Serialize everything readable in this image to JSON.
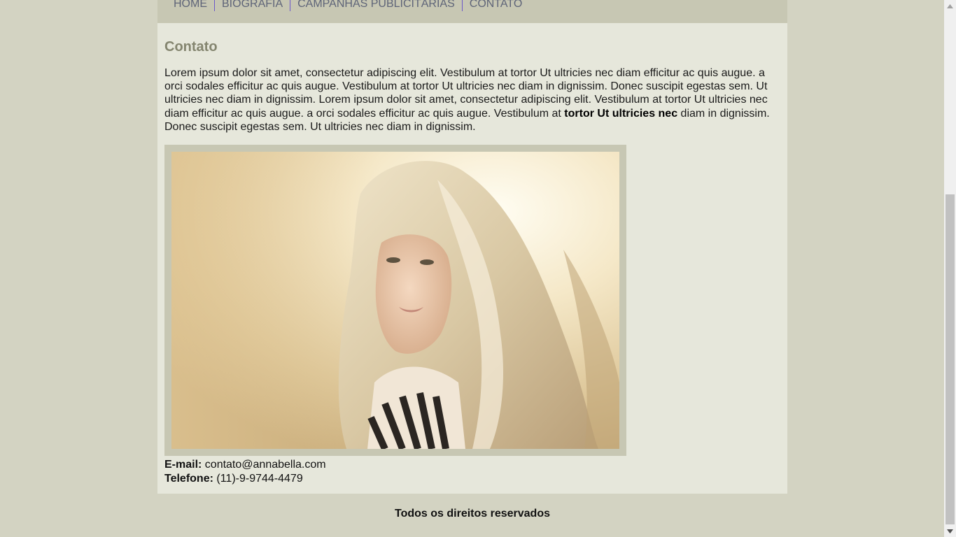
{
  "nav": {
    "items": [
      {
        "label": "HOME"
      },
      {
        "label": "BIOGRAFIA"
      },
      {
        "label": "CAMPANHAS PUBLICITÁRIAS"
      },
      {
        "label": "CONTATO"
      }
    ]
  },
  "main": {
    "title": "Contato",
    "intro_before": "Lorem ipsum dolor sit amet, consectetur adipiscing elit. Vestibulum at tortor Ut ultricies nec diam efficitur ac quis augue. a orci sodales efficitur ac quis augue. Vestibulum at tortor Ut ultricies nec diam in dignissim. Donec suscipit egestas sem. Ut ultricies nec diam in dignissim. Lorem ipsum dolor sit amet, consectetur adipiscing elit. Vestibulum at tortor Ut ultricies nec diam efficitur ac quis augue. a orci sodales efficitur ac quis augue. Vestibulum at ",
    "intro_bold": "tortor Ut ultricies nec",
    "intro_after": " diam in dignissim. Donec suscipit egestas sem. Ut ultricies nec diam in dignissim.",
    "contact": {
      "email_label": "E-mail:",
      "email_value": " contato@annabella.com",
      "phone_label": "Telefone:",
      "phone_value": " (11)-9-9744-4479"
    }
  },
  "footer": {
    "text": "Todos os direitos reservados"
  },
  "colors": {
    "page_background": "#d3d3c2",
    "nav_background": "#c7c7b3",
    "content_background": "#e6e7db",
    "nav_link": "#5e6478",
    "title": "#84856f"
  }
}
